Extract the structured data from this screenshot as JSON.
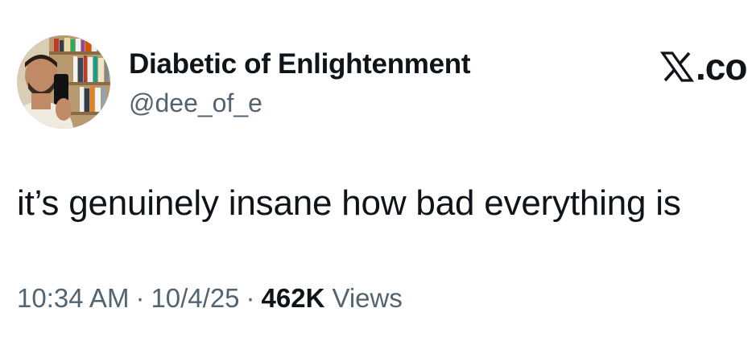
{
  "author": {
    "display_name": "Diabetic of Enlightenment",
    "handle": "@dee_of_e"
  },
  "brand": {
    "logo_icon": "x-logo-icon",
    "text": ".co"
  },
  "tweet": {
    "text": "it’s genuinely insane how bad everything is"
  },
  "meta": {
    "time": "10:34 AM",
    "separator": "·",
    "date": "10/4/25",
    "views_count": "462K",
    "views_label": "Views"
  },
  "colors": {
    "primary_text": "#0f1419",
    "secondary_text": "#536471",
    "background": "#ffffff"
  }
}
